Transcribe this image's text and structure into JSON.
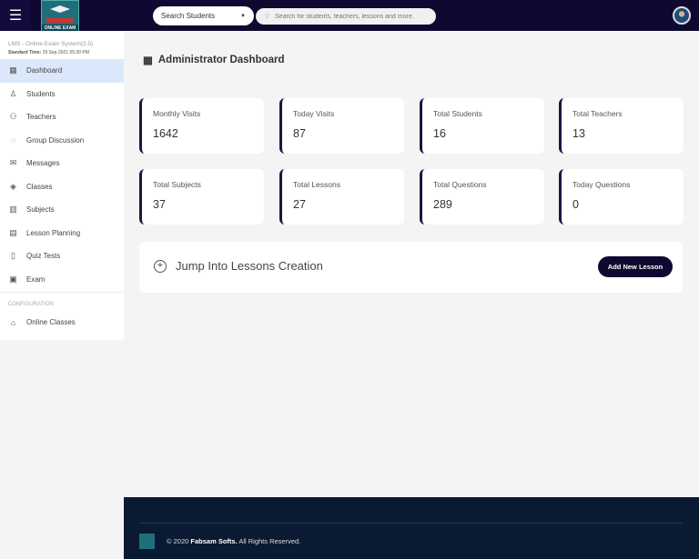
{
  "header": {
    "menu_icon": "hamburger-icon",
    "logo_text": "ONLINE EXAM",
    "search_select": "Search Students",
    "search_placeholder": "Search for students, teachers, lessons and more."
  },
  "sidebar": {
    "system": "LMS - Online Exam System(2.5)",
    "time_label": "Standard Time:",
    "time_value": "29 Sep 2021 05:30 PM",
    "items": [
      {
        "label": "Dashboard",
        "icon": "▦"
      },
      {
        "label": "Students",
        "icon": "♙"
      },
      {
        "label": "Teachers",
        "icon": "⚇"
      },
      {
        "label": "Group Discussion",
        "icon": "◌"
      },
      {
        "label": "Messages",
        "icon": "✉"
      },
      {
        "label": "Classes",
        "icon": "◈"
      },
      {
        "label": "Subjects",
        "icon": "▥"
      },
      {
        "label": "Lesson Planning",
        "icon": "▤"
      },
      {
        "label": "Quiz Tests",
        "icon": "▯"
      },
      {
        "label": "Exam",
        "icon": "▣"
      }
    ],
    "section": "CONFIGURATION",
    "config_items": [
      {
        "label": "Online Classes",
        "icon": "⌂"
      }
    ]
  },
  "main": {
    "title": "Administrator Dashboard",
    "stats": [
      {
        "label": "Monthly Visits",
        "value": "1642"
      },
      {
        "label": "Today Visits",
        "value": "87"
      },
      {
        "label": "Total Students",
        "value": "16"
      },
      {
        "label": "Total Teachers",
        "value": "13"
      },
      {
        "label": "Total Subjects",
        "value": "37"
      },
      {
        "label": "Total Lessons",
        "value": "27"
      },
      {
        "label": "Total Questions",
        "value": "289"
      },
      {
        "label": "Today Questions",
        "value": "0"
      }
    ],
    "jump": "Jump Into Lessons Creation",
    "add_button": "Add New Lesson"
  },
  "footer": {
    "prefix": "© 2020",
    "company": "Fabsam Softs.",
    "suffix": "All Rights Reserved."
  },
  "colors": {
    "header": "#0f0830",
    "footer": "#0a1a33",
    "active": "#dbe8fc"
  }
}
